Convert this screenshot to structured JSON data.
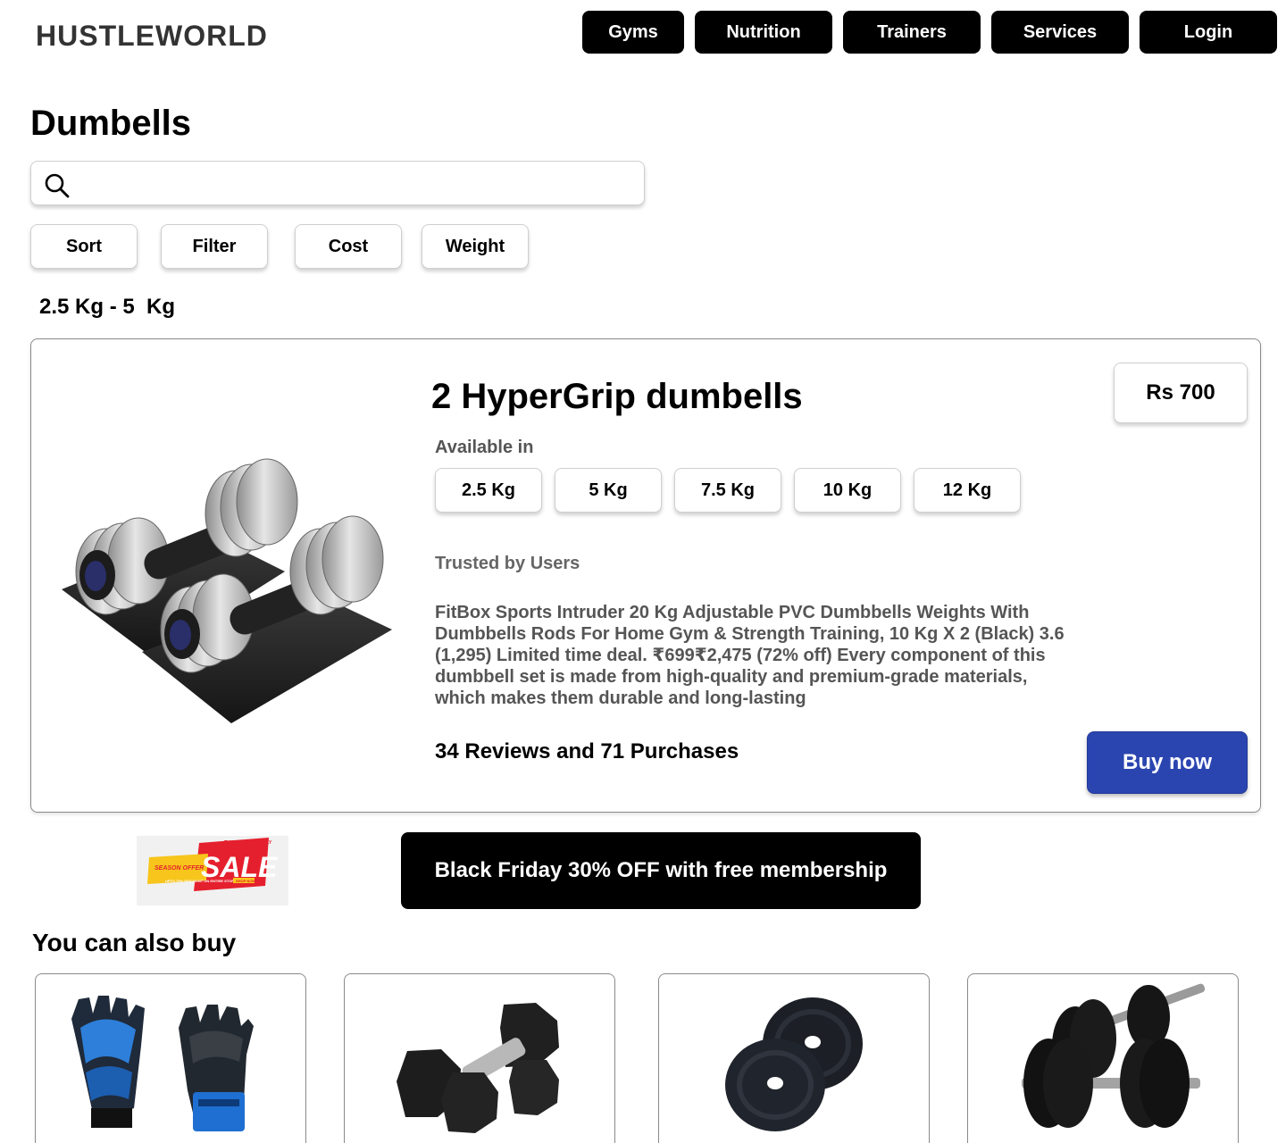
{
  "header": {
    "brand": "HUSTLEWORLD",
    "nav": [
      "Gyms",
      "Nutrition",
      "Trainers",
      "Services",
      "Login"
    ]
  },
  "page": {
    "title": "Dumbells",
    "search": {
      "value": "",
      "placeholder": ""
    },
    "filters": [
      "Sort",
      "Filter",
      "Cost",
      "Weight"
    ],
    "weight_range": "2.5 Kg - 5  Kg"
  },
  "product": {
    "title": "2 HyperGrip dumbells",
    "price": "Rs 700",
    "available_label": "Available in",
    "weights": [
      "2.5 Kg",
      "5 Kg",
      "7.5 Kg",
      "10 Kg",
      "12 Kg"
    ],
    "trusted": "Trusted by Users",
    "description": "FitBox Sports Intruder 20 Kg Adjustable PVC Dumbbells Weights With Dumbbells Rods For Home Gym & Strength Training, 10 Kg X 2 (Black) 3.6 (1,295) Limited time deal. ₹699₹2,475 (72% off) Every component of this dumbbell set is made from high-quality and premium-grade materials, which makes them durable and long-lasting",
    "stats": "34 Reviews and 71 Purchases",
    "buy_label": "Buy now"
  },
  "promo": {
    "sale_badge": {
      "top": "THIS WEEKEND ONLY",
      "offer": "SEASON OFFER",
      "sale": "SALE",
      "sub": "UPTO 70% DISCOUNT ON ENTIRE STORE",
      "shop": "SHOP NOW"
    },
    "text": "Black Friday 30% OFF with free membership"
  },
  "recommendations": {
    "title": "You can also buy",
    "items": [
      {
        "icon": "gym-gloves-icon"
      },
      {
        "icon": "hex-dumbbells-icon"
      },
      {
        "icon": "weight-plates-icon"
      },
      {
        "icon": "plate-dumbbells-icon"
      }
    ]
  },
  "colors": {
    "accent": "#2b45b0",
    "nav_bg": "#000000",
    "text_muted": "#555555"
  }
}
